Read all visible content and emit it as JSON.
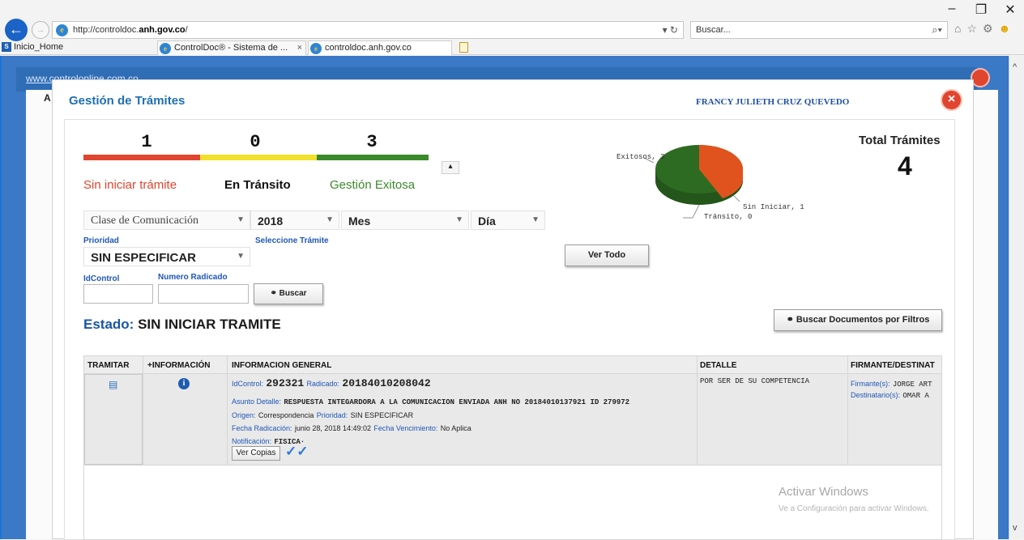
{
  "browser": {
    "url_prefix": "http://controldoc.",
    "url_domain": "anh.gov.co",
    "url_suffix": "/",
    "search_placeholder": "Buscar...",
    "home_tab": "Inicio_Home",
    "tabs": [
      {
        "label": "ControlDoc® - Sistema de ..."
      },
      {
        "label": "controldoc.anh.gov.co"
      }
    ]
  },
  "background": {
    "link_text": "www.controlonline.com.co",
    "letter": "A"
  },
  "modal": {
    "title": "Gestión de Trámites",
    "user": "FRANCY JULIETH CRUZ QUEVEDO",
    "counts": {
      "sin_iniciar": "1",
      "en_transito": "0",
      "exitosa": "3"
    },
    "labels": {
      "sin_iniciar": "Sin iniciar trámite",
      "en_transito": "En Tránsito",
      "exitosa": "Gestión Exitosa"
    },
    "colors": {
      "sin_iniciar": "#e0452f",
      "en_transito": "#f1e12b",
      "exitosa": "#3a8a2a",
      "pie_exitosos": "#2e6b22",
      "pie_sin_iniciar": "#e0531f"
    },
    "total_label": "Total Trámites",
    "total_value": "4",
    "pie": {
      "exitosos": "Exitosos, 3",
      "sin_iniciar": "Sin Iniciar, 1",
      "transito": "Tránsito, 0"
    },
    "filters": {
      "clase": "Clase de Comunicación",
      "year": "2018",
      "mes": "Mes",
      "dia": "Día",
      "prioridad_label": "Prioridad",
      "prioridad_value": "SIN ESPECIFICAR",
      "seleccione_tramite": "Seleccione Trámite",
      "idcontrol_label": "IdControl",
      "radicado_label": "Numero Radicado",
      "buscar": "Buscar",
      "ver_todo": "Ver Todo",
      "buscar_filtros": "Buscar Documentos por Filtros"
    },
    "estado_label": "Estado:",
    "estado_value": "SIN INICIAR TRAMITE"
  },
  "table": {
    "headers": [
      "TRAMITAR",
      "+INFORMACIÓN",
      "INFORMACION GENERAL",
      "DETALLE",
      "FIRMANTE/DESTINAT"
    ],
    "row": {
      "idcontrol_label": "IdControl:",
      "idcontrol": "292321",
      "radicado_label": "Radicado:",
      "radicado": "20184010208042",
      "asunto_label": "Asunto Detalle:",
      "asunto": "RESPUESTA INTEGARDORA A LA COMUNICACION ENVIADA ANH NO 20184010137921 ID 279972",
      "origen_label": "Origen:",
      "origen": "Correspondencia",
      "prioridad_label": "Prioridad:",
      "prioridad": "SIN ESPECIFICAR",
      "fecha_rad_label": "Fecha Radicación:",
      "fecha_rad": "junio 28, 2018 14:49:02",
      "fecha_venc_label": "Fecha Vencimiento:",
      "fecha_venc": "No Aplica",
      "notif_label": "Notificación:",
      "notif": "FISICA·",
      "ver_copias": "Ver Copias",
      "detalle": "POR SER DE SU COMPETENCIA",
      "firmante_label": "Firmante(s):",
      "firmante": "JORGE ART",
      "destinatario_label": "Destinatario(s):",
      "destinatario": "OMAR A"
    }
  },
  "watermark": {
    "line1": "Activar Windows",
    "line2": "Ve a Configuración para activar Windows."
  }
}
